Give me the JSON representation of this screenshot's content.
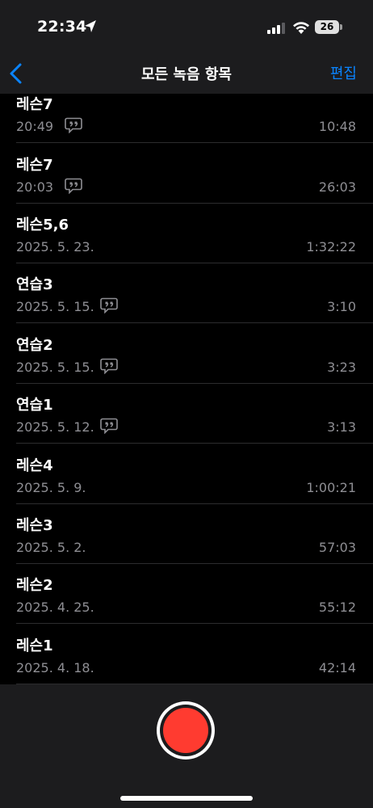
{
  "status": {
    "time": "22:34",
    "battery": "26"
  },
  "nav": {
    "title": "모든 녹음 항목",
    "edit_label": "편집"
  },
  "recordings": [
    {
      "title": "레슨7",
      "date": "20:49",
      "duration": "10:48",
      "transcript": true
    },
    {
      "title": "레슨7",
      "date": "20:03",
      "duration": "26:03",
      "transcript": true
    },
    {
      "title": "레슨5,6",
      "date": "2025. 5. 23.",
      "duration": "1:32:22",
      "transcript": false
    },
    {
      "title": "연습3",
      "date": "2025. 5. 15.",
      "duration": "3:10",
      "transcript": true
    },
    {
      "title": "연습2",
      "date": "2025. 5. 15.",
      "duration": "3:23",
      "transcript": true
    },
    {
      "title": "연습1",
      "date": "2025. 5. 12.",
      "duration": "3:13",
      "transcript": true
    },
    {
      "title": "레슨4",
      "date": "2025. 5. 9.",
      "duration": "1:00:21",
      "transcript": false
    },
    {
      "title": "레슨3",
      "date": "2025. 5. 2.",
      "duration": "57:03",
      "transcript": false
    },
    {
      "title": "레슨2",
      "date": "2025. 4. 25.",
      "duration": "55:12",
      "transcript": false
    },
    {
      "title": "레슨1",
      "date": "2025. 4. 18.",
      "duration": "42:14",
      "transcript": false
    }
  ],
  "icons": {
    "back": "chevron-left-icon",
    "transcript": "quote-bubble-icon",
    "record": "record-icon"
  },
  "colors": {
    "accent": "#0a84ff",
    "record": "#ff3b30",
    "secondary_text": "#8e8e93"
  }
}
